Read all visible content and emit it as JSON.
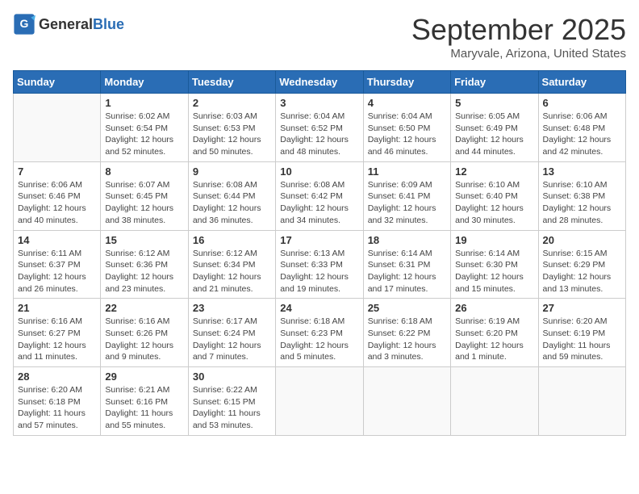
{
  "header": {
    "logo_general": "General",
    "logo_blue": "Blue",
    "month": "September 2025",
    "location": "Maryvale, Arizona, United States"
  },
  "days_of_week": [
    "Sunday",
    "Monday",
    "Tuesday",
    "Wednesday",
    "Thursday",
    "Friday",
    "Saturday"
  ],
  "weeks": [
    [
      {
        "day": "",
        "detail": ""
      },
      {
        "day": "1",
        "detail": "Sunrise: 6:02 AM\nSunset: 6:54 PM\nDaylight: 12 hours\nand 52 minutes."
      },
      {
        "day": "2",
        "detail": "Sunrise: 6:03 AM\nSunset: 6:53 PM\nDaylight: 12 hours\nand 50 minutes."
      },
      {
        "day": "3",
        "detail": "Sunrise: 6:04 AM\nSunset: 6:52 PM\nDaylight: 12 hours\nand 48 minutes."
      },
      {
        "day": "4",
        "detail": "Sunrise: 6:04 AM\nSunset: 6:50 PM\nDaylight: 12 hours\nand 46 minutes."
      },
      {
        "day": "5",
        "detail": "Sunrise: 6:05 AM\nSunset: 6:49 PM\nDaylight: 12 hours\nand 44 minutes."
      },
      {
        "day": "6",
        "detail": "Sunrise: 6:06 AM\nSunset: 6:48 PM\nDaylight: 12 hours\nand 42 minutes."
      }
    ],
    [
      {
        "day": "7",
        "detail": "Sunrise: 6:06 AM\nSunset: 6:46 PM\nDaylight: 12 hours\nand 40 minutes."
      },
      {
        "day": "8",
        "detail": "Sunrise: 6:07 AM\nSunset: 6:45 PM\nDaylight: 12 hours\nand 38 minutes."
      },
      {
        "day": "9",
        "detail": "Sunrise: 6:08 AM\nSunset: 6:44 PM\nDaylight: 12 hours\nand 36 minutes."
      },
      {
        "day": "10",
        "detail": "Sunrise: 6:08 AM\nSunset: 6:42 PM\nDaylight: 12 hours\nand 34 minutes."
      },
      {
        "day": "11",
        "detail": "Sunrise: 6:09 AM\nSunset: 6:41 PM\nDaylight: 12 hours\nand 32 minutes."
      },
      {
        "day": "12",
        "detail": "Sunrise: 6:10 AM\nSunset: 6:40 PM\nDaylight: 12 hours\nand 30 minutes."
      },
      {
        "day": "13",
        "detail": "Sunrise: 6:10 AM\nSunset: 6:38 PM\nDaylight: 12 hours\nand 28 minutes."
      }
    ],
    [
      {
        "day": "14",
        "detail": "Sunrise: 6:11 AM\nSunset: 6:37 PM\nDaylight: 12 hours\nand 26 minutes."
      },
      {
        "day": "15",
        "detail": "Sunrise: 6:12 AM\nSunset: 6:36 PM\nDaylight: 12 hours\nand 23 minutes."
      },
      {
        "day": "16",
        "detail": "Sunrise: 6:12 AM\nSunset: 6:34 PM\nDaylight: 12 hours\nand 21 minutes."
      },
      {
        "day": "17",
        "detail": "Sunrise: 6:13 AM\nSunset: 6:33 PM\nDaylight: 12 hours\nand 19 minutes."
      },
      {
        "day": "18",
        "detail": "Sunrise: 6:14 AM\nSunset: 6:31 PM\nDaylight: 12 hours\nand 17 minutes."
      },
      {
        "day": "19",
        "detail": "Sunrise: 6:14 AM\nSunset: 6:30 PM\nDaylight: 12 hours\nand 15 minutes."
      },
      {
        "day": "20",
        "detail": "Sunrise: 6:15 AM\nSunset: 6:29 PM\nDaylight: 12 hours\nand 13 minutes."
      }
    ],
    [
      {
        "day": "21",
        "detail": "Sunrise: 6:16 AM\nSunset: 6:27 PM\nDaylight: 12 hours\nand 11 minutes."
      },
      {
        "day": "22",
        "detail": "Sunrise: 6:16 AM\nSunset: 6:26 PM\nDaylight: 12 hours\nand 9 minutes."
      },
      {
        "day": "23",
        "detail": "Sunrise: 6:17 AM\nSunset: 6:24 PM\nDaylight: 12 hours\nand 7 minutes."
      },
      {
        "day": "24",
        "detail": "Sunrise: 6:18 AM\nSunset: 6:23 PM\nDaylight: 12 hours\nand 5 minutes."
      },
      {
        "day": "25",
        "detail": "Sunrise: 6:18 AM\nSunset: 6:22 PM\nDaylight: 12 hours\nand 3 minutes."
      },
      {
        "day": "26",
        "detail": "Sunrise: 6:19 AM\nSunset: 6:20 PM\nDaylight: 12 hours\nand 1 minute."
      },
      {
        "day": "27",
        "detail": "Sunrise: 6:20 AM\nSunset: 6:19 PM\nDaylight: 11 hours\nand 59 minutes."
      }
    ],
    [
      {
        "day": "28",
        "detail": "Sunrise: 6:20 AM\nSunset: 6:18 PM\nDaylight: 11 hours\nand 57 minutes."
      },
      {
        "day": "29",
        "detail": "Sunrise: 6:21 AM\nSunset: 6:16 PM\nDaylight: 11 hours\nand 55 minutes."
      },
      {
        "day": "30",
        "detail": "Sunrise: 6:22 AM\nSunset: 6:15 PM\nDaylight: 11 hours\nand 53 minutes."
      },
      {
        "day": "",
        "detail": ""
      },
      {
        "day": "",
        "detail": ""
      },
      {
        "day": "",
        "detail": ""
      },
      {
        "day": "",
        "detail": ""
      }
    ]
  ]
}
